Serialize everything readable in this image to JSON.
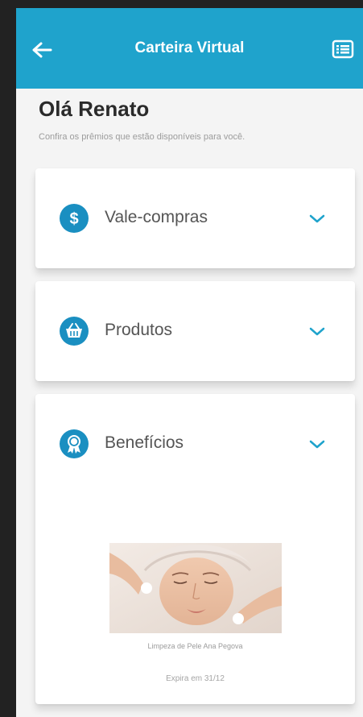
{
  "header": {
    "title": "Carteira Virtual",
    "back_icon": "arrow-left-icon",
    "menu_icon": "list-icon",
    "bg_color": "#1fa3cc"
  },
  "greeting": {
    "title": "Olá Renato",
    "subtitle": "Confira os prêmios que estão disponíveis para você."
  },
  "sections": [
    {
      "label": "Vale-compras",
      "icon": "dollar-icon",
      "expanded": false
    },
    {
      "label": "Produtos",
      "icon": "basket-icon",
      "expanded": false
    },
    {
      "label": "Benefícios",
      "icon": "award-badge-icon",
      "expanded": true
    }
  ],
  "benefit_item": {
    "name": "Limpeza de Pele Ana Pegova",
    "expiry": "Expira em 31/12"
  },
  "colors": {
    "accent": "#1fa3cc",
    "icon_bg": "#1a8fc1",
    "background": "#f4f4f4"
  }
}
